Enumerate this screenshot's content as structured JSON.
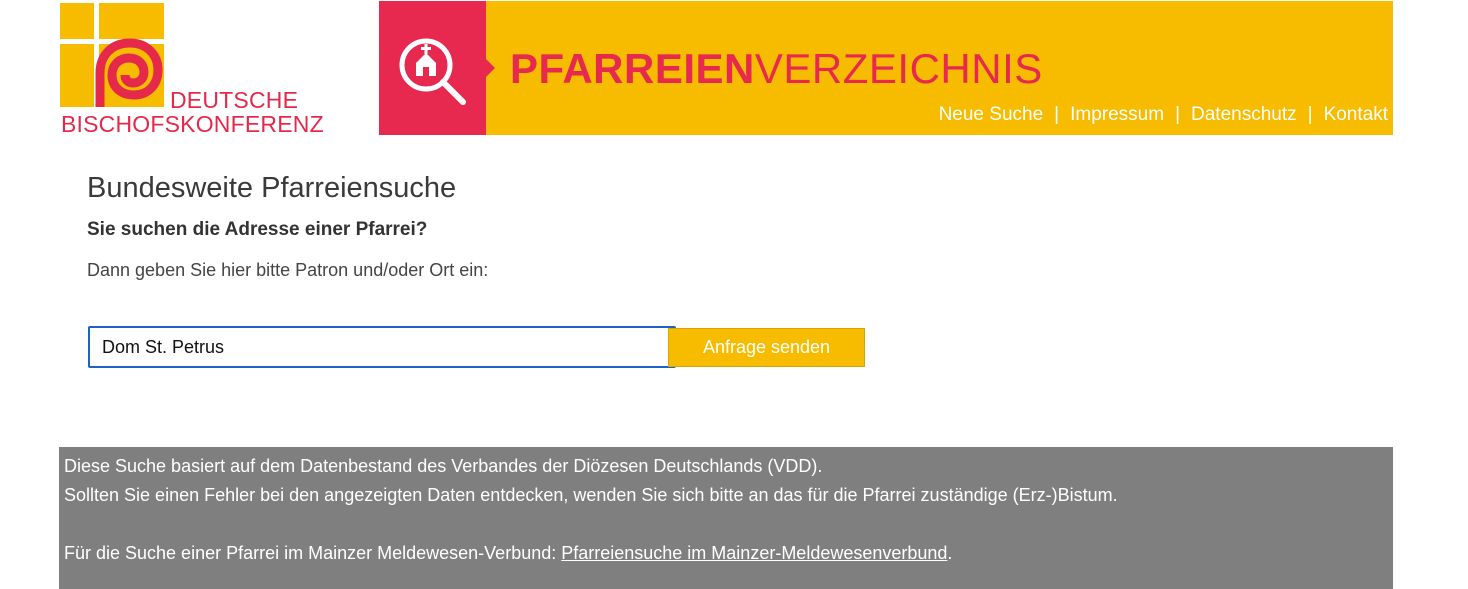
{
  "logo": {
    "line1": "DEUTSCHE",
    "line2": "BISCHOFSKONFERENZ",
    "color_red": "#e5294a",
    "color_yellow": "#f7bb00"
  },
  "banner": {
    "title_bold": "PFARREIEN",
    "title_light": "VERZEICHNIS",
    "icon": "church-search-icon",
    "background": "#f7bb00",
    "accent": "#e8294f"
  },
  "nav": {
    "items": [
      "Neue Suche",
      "Impressum",
      "Datenschutz",
      "Kontakt"
    ],
    "separator": "|"
  },
  "main": {
    "title": "Bundesweite Pfarreiensuche",
    "subtitle": "Sie suchen die Adresse einer Pfarrei?",
    "instruction": "Dann geben Sie hier bitte Patron und/oder Ort ein:"
  },
  "search": {
    "value": "Dom St. Petrus",
    "button_label": "Anfrage senden"
  },
  "info": {
    "line1": "Diese Suche basiert auf dem Datenbestand des Verbandes der Diözesen Deutschlands (VDD).",
    "line2": "Sollten Sie einen Fehler bei den angezeigten Daten entdecken, wenden Sie sich bitte an das für die Pfarrei zuständige (Erz-)Bistum.",
    "line3_prefix": "Für die Suche einer Pfarrei im Mainzer Meldewesen-Verbund: ",
    "line3_link": "Pfarreiensuche im Mainzer-Meldewesenverbund",
    "line3_suffix": ".",
    "background": "#7f7f7f"
  }
}
